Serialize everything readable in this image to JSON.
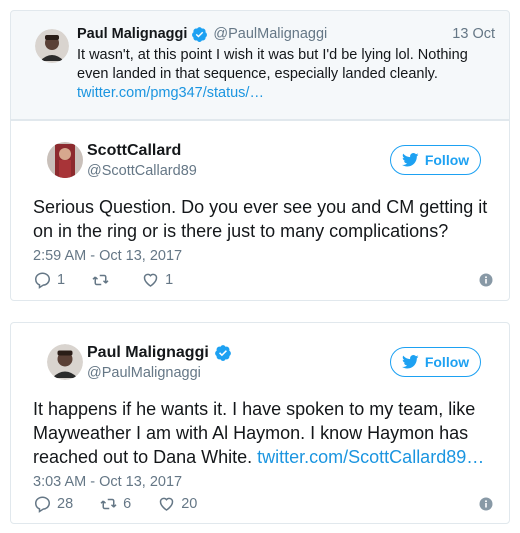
{
  "quoted": {
    "name": "Paul Malignaggi",
    "handle": "@PaulMalignaggi",
    "time": "13 Oct",
    "text": "It wasn't, at this point I wish it was but I'd be lying lol. Nothing even landed in that sequence, especially landed cleanly.",
    "link": "twitter.com/pmg347/status/…"
  },
  "tweet1": {
    "name": "ScottCallard",
    "handle": "@ScottCallard89",
    "follow_label": "Follow",
    "text": "Serious Question. Do you ever see you and CM getting it on in the ring or is there just to many complications?",
    "date": "2:59 AM - Oct 13, 2017",
    "reply_count": "1",
    "retweet_count": "",
    "like_count": "1"
  },
  "tweet2": {
    "name": "Paul Malignaggi",
    "handle": "@PaulMalignaggi",
    "follow_label": "Follow",
    "text": "It happens if he wants it. I have spoken to my team, like Mayweather I am with Al Haymon. I know Haymon has reached out to Dana White. ",
    "link": "twitter.com/ScottCallard89…",
    "date": "3:03 AM - Oct 13, 2017",
    "reply_count": "28",
    "retweet_count": "6",
    "like_count": "20"
  },
  "colors": {
    "accent": "#1da1f2",
    "link": "#1b95e0",
    "muted": "#657786",
    "border": "#e1e8ed"
  }
}
